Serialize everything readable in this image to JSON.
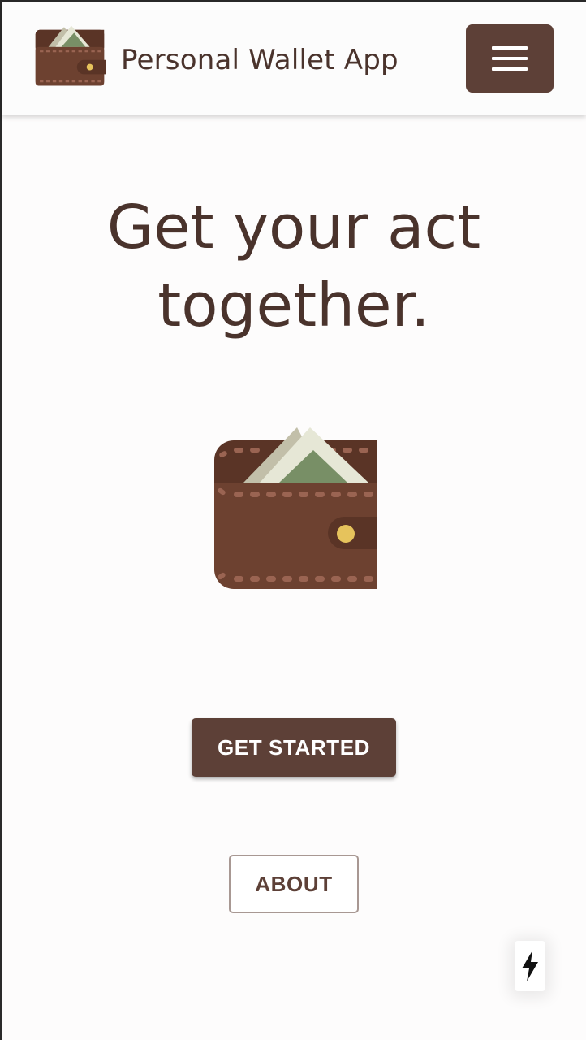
{
  "header": {
    "app_title": "Personal Wallet App",
    "logo_icon": "wallet-icon",
    "menu_icon": "hamburger-menu-icon"
  },
  "hero": {
    "headline_line1": "Get your act",
    "headline_line2": "together.",
    "illustration": "wallet-icon"
  },
  "actions": {
    "get_started_label": "GET STARTED",
    "about_label": "ABOUT"
  },
  "fab": {
    "icon": "lightning-bolt-icon"
  },
  "colors": {
    "primary": "#5d4037",
    "text": "#4a332c",
    "background": "#fdfcfc",
    "wallet_body": "#6d4130",
    "wallet_flap": "#5a3426",
    "wallet_stitch": "#9a6452",
    "bill_green": "#788f66",
    "bill_light": "#e6e7d6",
    "bill_back": "#c2bfa9",
    "button_dot": "#e6c35c"
  }
}
